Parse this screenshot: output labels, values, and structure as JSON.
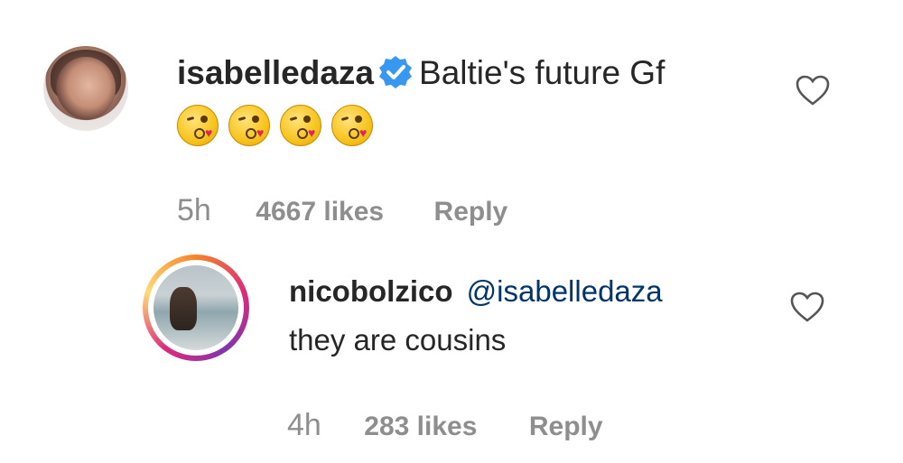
{
  "comments": [
    {
      "username": "isabelledaza",
      "verified": true,
      "text": "Baltie's future Gf",
      "emoji": [
        "kissing-heart-emoji",
        "kissing-heart-emoji",
        "kissing-heart-emoji",
        "kissing-heart-emoji"
      ],
      "time": "5h",
      "likes": "4667 likes",
      "reply_label": "Reply"
    },
    {
      "username": "nicobolzico",
      "mention": "@isabelledaza",
      "text": "they are cousins",
      "time": "4h",
      "likes": "283 likes",
      "reply_label": "Reply",
      "has_story_ring": true
    }
  ],
  "icons": {
    "like": "heart-outline-icon",
    "verified": "verified-badge-icon"
  },
  "colors": {
    "text": "#262626",
    "meta": "#8e8e8e",
    "mention": "#003569",
    "verified": "#3897f0"
  }
}
